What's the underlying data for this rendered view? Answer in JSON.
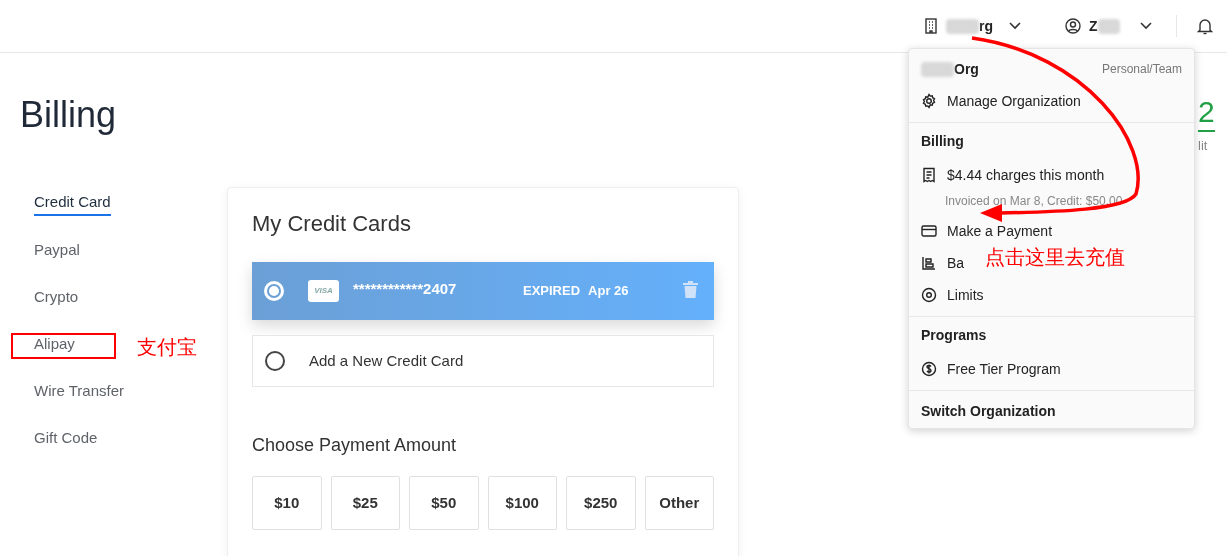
{
  "header": {
    "org_label": "rg",
    "user_label": "Z"
  },
  "page_title": "Billing",
  "sidebar": {
    "items": [
      {
        "label": "Credit Card",
        "selected": true
      },
      {
        "label": "Paypal",
        "selected": false
      },
      {
        "label": "Crypto",
        "selected": false
      },
      {
        "label": "Alipay",
        "selected": false
      },
      {
        "label": "Wire Transfer",
        "selected": false
      },
      {
        "label": "Gift Code",
        "selected": false
      }
    ]
  },
  "cards_panel": {
    "title": "My Credit Cards",
    "cards": [
      {
        "kind": "saved",
        "brand": "VISA",
        "number": "************2407",
        "status": "EXPIRED",
        "expiry": "Apr 26",
        "selected": true
      },
      {
        "kind": "new",
        "label": "Add a New Credit Card",
        "selected": false
      }
    ],
    "amount_title": "Choose Payment Amount",
    "amounts": [
      "$10",
      "$25",
      "$50",
      "$100",
      "$250",
      "Other"
    ]
  },
  "background_peek": {
    "value": "2",
    "label": "lit"
  },
  "menu": {
    "org_name": "Org",
    "org_type": "Personal/Team",
    "items": [
      {
        "kind": "gear",
        "label": "Manage Organization"
      }
    ],
    "sections": [
      {
        "title": "Billing",
        "items": [
          {
            "kind": "receipt",
            "label": "$4.44 charges this month",
            "note": "Invoiced on Mar 8, Credit: $50.00"
          },
          {
            "kind": "card",
            "label": "Make a Payment"
          },
          {
            "kind": "bars",
            "label": "Ba"
          },
          {
            "kind": "target",
            "label": "Limits"
          }
        ]
      },
      {
        "title": "Programs",
        "items": [
          {
            "kind": "dollar",
            "label": "Free Tier Program"
          }
        ]
      }
    ],
    "footer": "Switch Organization"
  },
  "annotations": {
    "sidebar_note": "支付宝",
    "menu_note": "点击这里去充值"
  }
}
